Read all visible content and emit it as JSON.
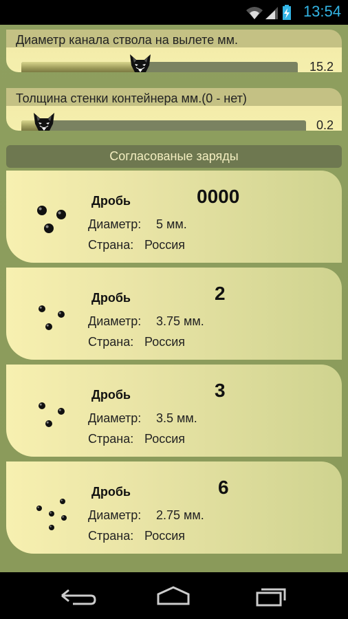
{
  "status": {
    "time": "13:54"
  },
  "sliders": [
    {
      "label": "Диаметр канала ствола на вылете мм.",
      "value": "15.2",
      "fraction": 0.43
    },
    {
      "label": "Толщина стенки контейнера мм.(0 - нет)",
      "value": "0.2",
      "fraction": 0.08
    }
  ],
  "section": {
    "title": "Согласованые заряды"
  },
  "charges": [
    {
      "type": "Дробь",
      "number": "0000",
      "diameter_label": "Диаметр:",
      "diameter": "5 мм.",
      "country_label": "Страна:",
      "country": "Россия",
      "pellet_count": 3
    },
    {
      "type": "Дробь",
      "number": "2",
      "diameter_label": "Диаметр:",
      "diameter": "3.75 мм.",
      "country_label": "Страна:",
      "country": "Россия",
      "pellet_count": 3
    },
    {
      "type": "Дробь",
      "number": "3",
      "diameter_label": "Диаметр:",
      "diameter": "3.5 мм.",
      "country_label": "Страна:",
      "country": "Россия",
      "pellet_count": 3
    },
    {
      "type": "Дробь",
      "number": "6",
      "diameter_label": "Диаметр:",
      "diameter": "2.75 мм.",
      "country_label": "Страна:",
      "country": "Россия",
      "pellet_count": 5
    }
  ],
  "colors": {
    "accent_clock": "#33b5e5",
    "card": "#f5efad",
    "background": "#8b9b5e"
  },
  "icons": [
    "wifi-icon",
    "signal-icon",
    "battery-charging-icon",
    "wolf-thumb-icon",
    "back-icon",
    "home-icon",
    "recent-apps-icon"
  ]
}
